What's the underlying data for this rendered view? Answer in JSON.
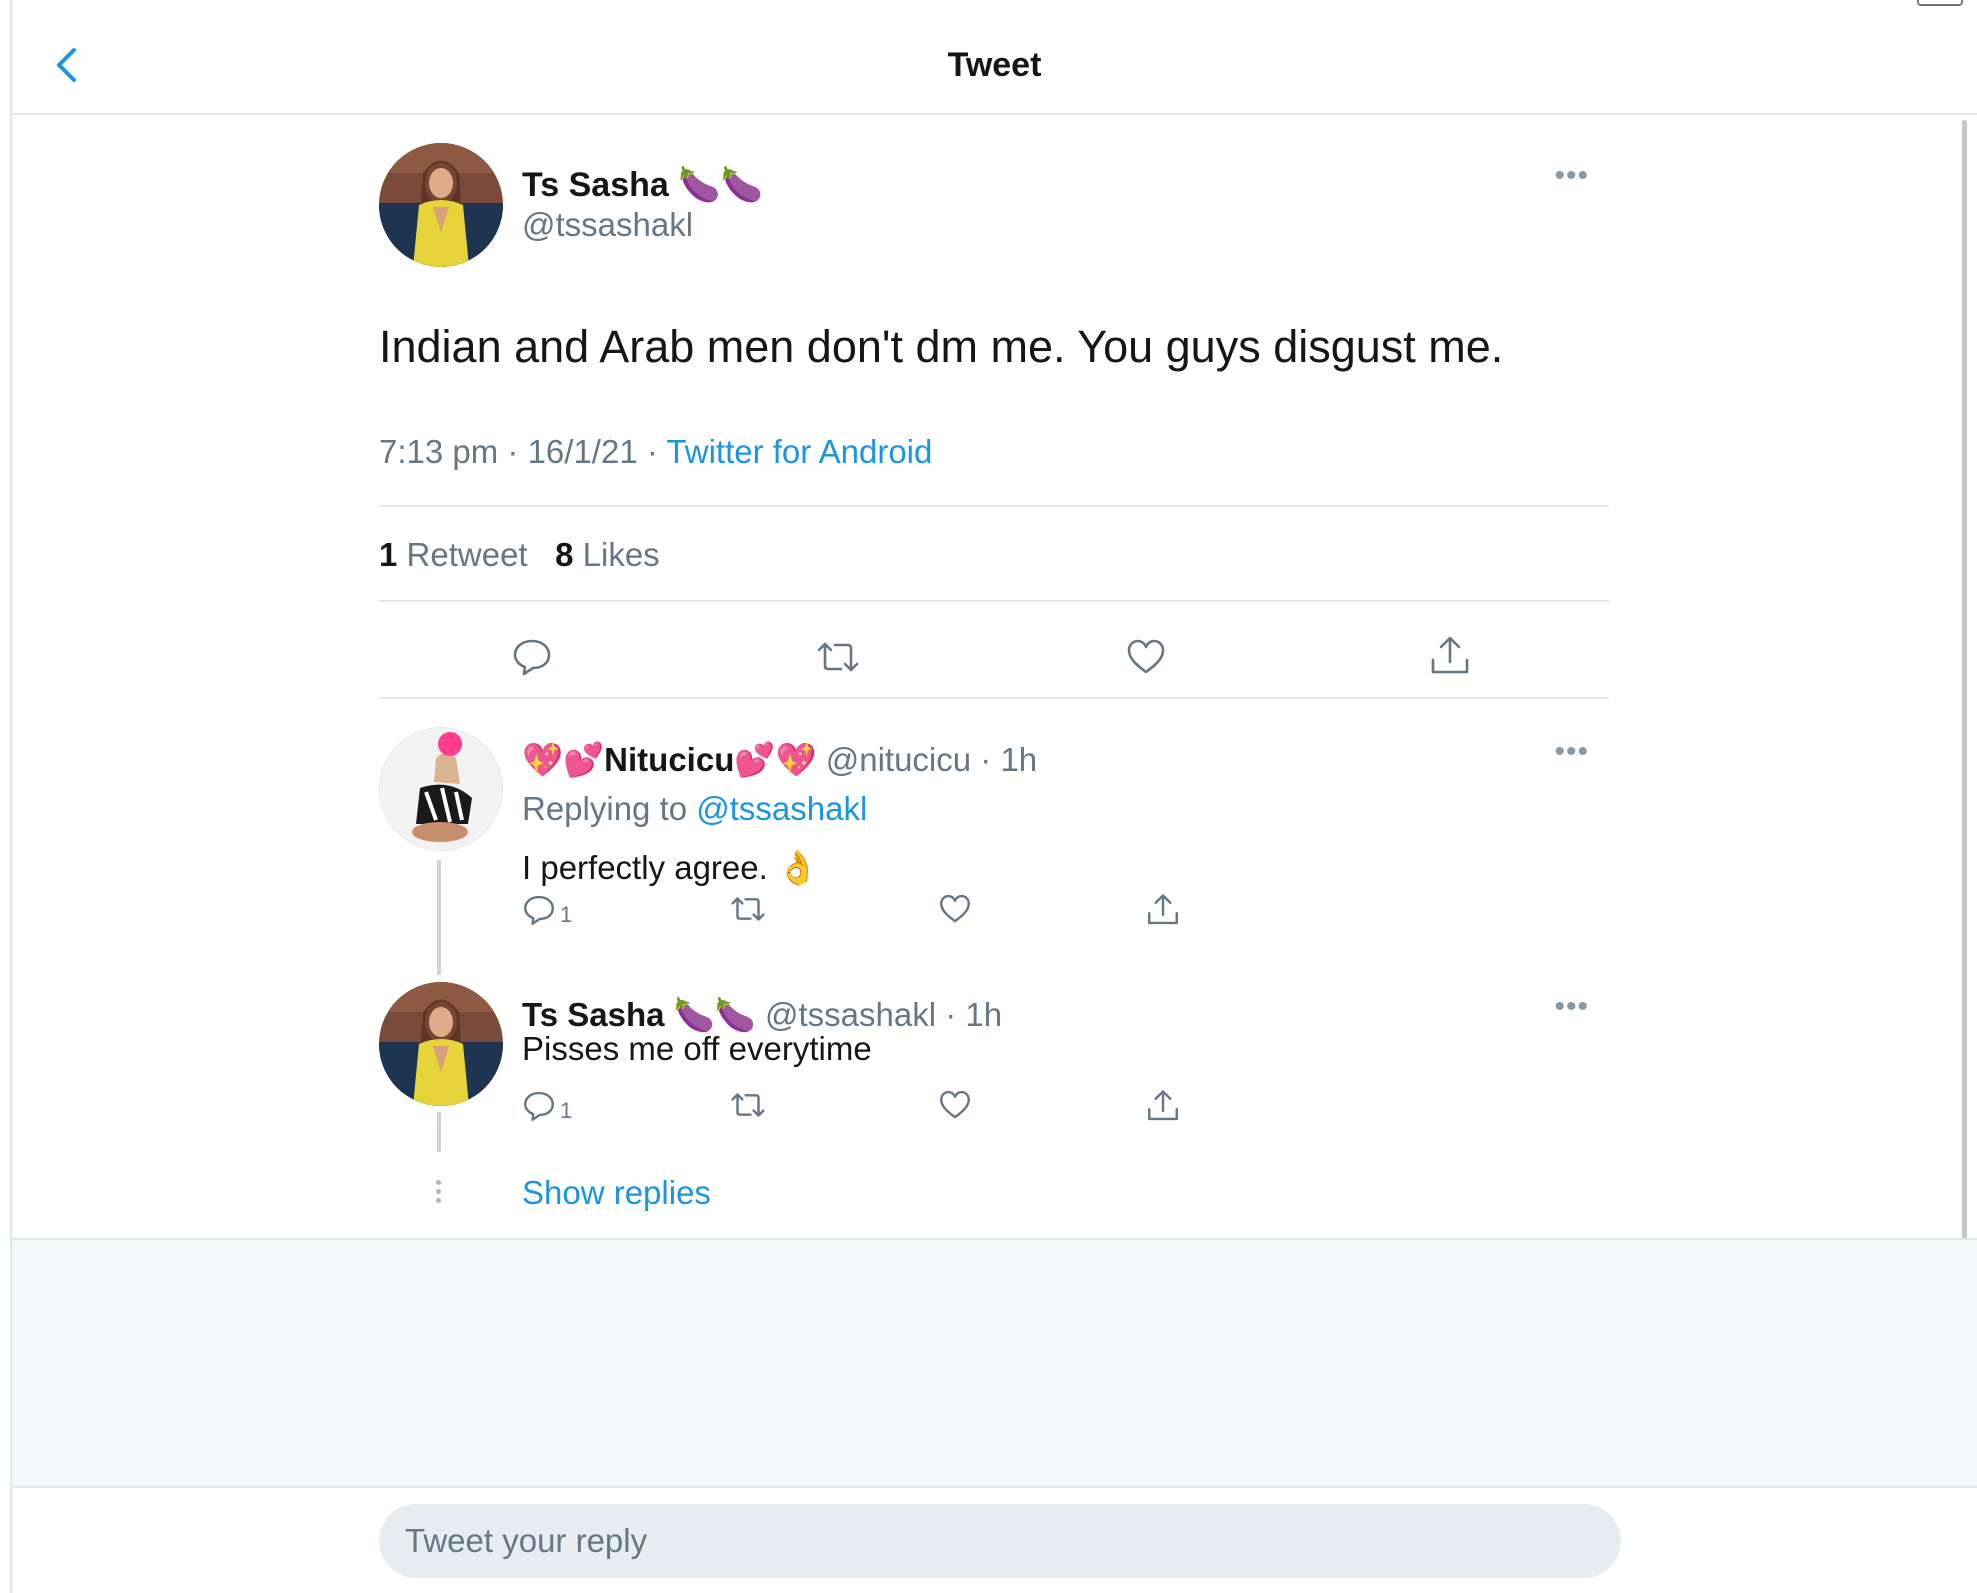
{
  "header": {
    "title": "Tweet"
  },
  "main_tweet": {
    "author_name": "Ts Sasha 🍆🍆",
    "author_handle": "@tssashakl",
    "text": "Indian and Arab men don't dm me. You guys disgust me.",
    "time": "7:13 pm · 16/1/21 · ",
    "source": "Twitter for Android",
    "retweets_count": "1",
    "retweets_label": "Retweet",
    "likes_count": "8",
    "likes_label": "Likes"
  },
  "replies": [
    {
      "author_name": "💖💕Nitucicu💕💖",
      "author_handle": "@nitucicu",
      "time": "· 1h",
      "replying_prefix": "Replying to ",
      "replying_to": "@tssashakl",
      "text": "I perfectly agree. 👌",
      "reply_count": "1"
    },
    {
      "author_name": "Ts Sasha 🍆🍆",
      "author_handle": "@tssashakl",
      "time": "· 1h",
      "text": "Pisses me off everytime",
      "reply_count": "1"
    }
  ],
  "show_replies": "Show replies",
  "compose": {
    "placeholder": "Tweet your reply"
  },
  "colors": {
    "accent": "#1b95e0",
    "muted": "#657786",
    "border": "#e1e8ed",
    "background_gray": "#f5f8fa"
  }
}
